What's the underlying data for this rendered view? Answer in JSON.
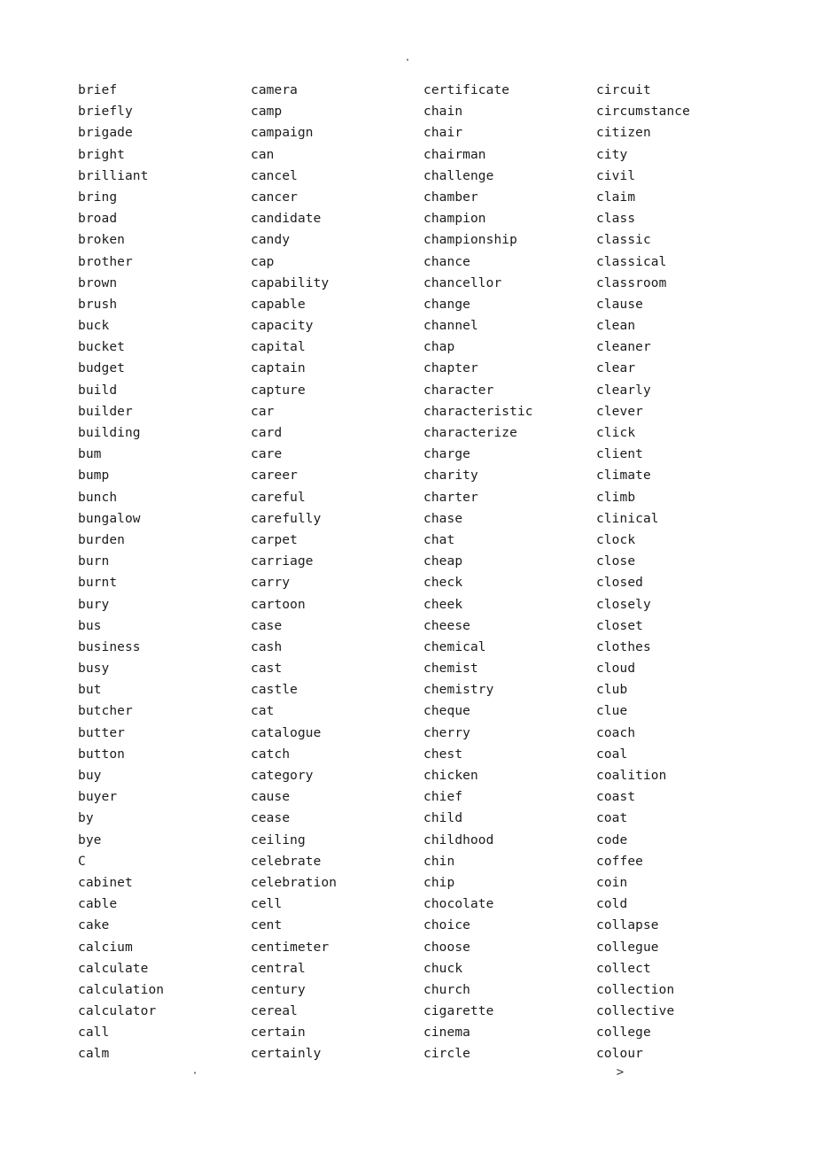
{
  "page": {
    "header_mark": "·",
    "footer_mark_left": "·",
    "footer_mark_right": ">"
  },
  "columns": [
    {
      "name": "column-1",
      "words": [
        "brief",
        "briefly",
        "brigade",
        "bright",
        "brilliant",
        "bring",
        "broad",
        "broken",
        "brother",
        "brown",
        "brush",
        "buck",
        "bucket",
        "budget",
        "build",
        "builder",
        "building",
        "bum",
        "bump",
        "bunch",
        "bungalow",
        "burden",
        "burn",
        "burnt",
        "bury",
        "bus",
        "business",
        "busy",
        "but",
        "butcher",
        "butter",
        "button",
        "buy",
        "buyer",
        "by",
        "bye",
        "C",
        "cabinet",
        "cable",
        "cake",
        "calcium",
        "calculate",
        "calculation",
        "calculator",
        "call",
        "calm"
      ]
    },
    {
      "name": "column-2",
      "words": [
        "camera",
        "camp",
        "campaign",
        "can",
        "cancel",
        "cancer",
        "candidate",
        "candy",
        "cap",
        "capability",
        "capable",
        "capacity",
        "capital",
        "captain",
        "capture",
        "car",
        "card",
        "care",
        "career",
        "careful",
        "carefully",
        "carpet",
        "carriage",
        "carry",
        "cartoon",
        "case",
        "cash",
        "cast",
        "castle",
        "cat",
        "catalogue",
        "catch",
        "category",
        "cause",
        "cease",
        "ceiling",
        "celebrate",
        "celebration",
        "cell",
        "cent",
        "centimeter",
        "central",
        "century",
        "cereal",
        "certain",
        "certainly"
      ]
    },
    {
      "name": "column-3",
      "words": [
        "certificate",
        "chain",
        "chair",
        "chairman",
        "challenge",
        "chamber",
        "champion",
        "championship",
        "chance",
        "chancellor",
        "change",
        "channel",
        "chap",
        "chapter",
        "character",
        "characteristic",
        "characterize",
        "charge",
        "charity",
        "charter",
        "chase",
        "chat",
        "cheap",
        "check",
        "cheek",
        "cheese",
        "chemical",
        "chemist",
        "chemistry",
        "cheque",
        "cherry",
        "chest",
        "chicken",
        "chief",
        "child",
        "childhood",
        "chin",
        "chip",
        "chocolate",
        "choice",
        "choose",
        "chuck",
        "church",
        "cigarette",
        "cinema",
        "circle"
      ]
    },
    {
      "name": "column-4",
      "words": [
        "circuit",
        "circumstance",
        "citizen",
        "city",
        "civil",
        "claim",
        "class",
        "classic",
        "classical",
        "classroom",
        "clause",
        "clean",
        "cleaner",
        "clear",
        "clearly",
        "clever",
        "click",
        "client",
        "climate",
        "climb",
        "clinical",
        "clock",
        "close",
        "closed",
        "closely",
        "closet",
        "clothes",
        "cloud",
        "club",
        "clue",
        "coach",
        "coal",
        "coalition",
        "coast",
        "coat",
        "code",
        "coffee",
        "coin",
        "cold",
        "collapse",
        "collegue",
        "collect",
        "collection",
        "collective",
        "college",
        "colour"
      ]
    }
  ]
}
